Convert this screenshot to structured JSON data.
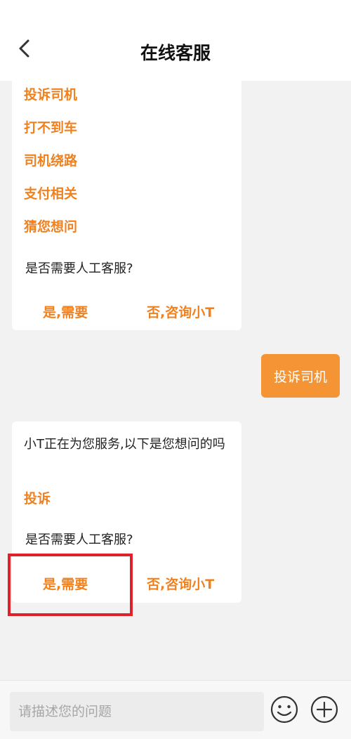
{
  "header": {
    "title": "在线客服"
  },
  "bot_message_1": {
    "options": [
      "投诉司机",
      "打不到车",
      "司机绕路",
      "支付相关",
      "猜您想问"
    ],
    "question": "是否需要人工客服?",
    "yes_label": "是,需要",
    "no_label": "否,咨询小T"
  },
  "user_message": {
    "text": "投诉司机"
  },
  "bot_message_2": {
    "text": "小T正在为您服务,以下是您想问的吗",
    "options": [
      "投诉"
    ],
    "question": "是否需要人工客服?",
    "yes_label": "是,需要",
    "no_label": "否,咨询小T"
  },
  "composer": {
    "placeholder": "请描述您的问题"
  },
  "colors": {
    "accent": "#f0811f",
    "user_bubble": "#f59435",
    "highlight": "#e0202a"
  },
  "icons": [
    "chevron-left-icon",
    "emoji-icon",
    "plus-circle-icon"
  ]
}
